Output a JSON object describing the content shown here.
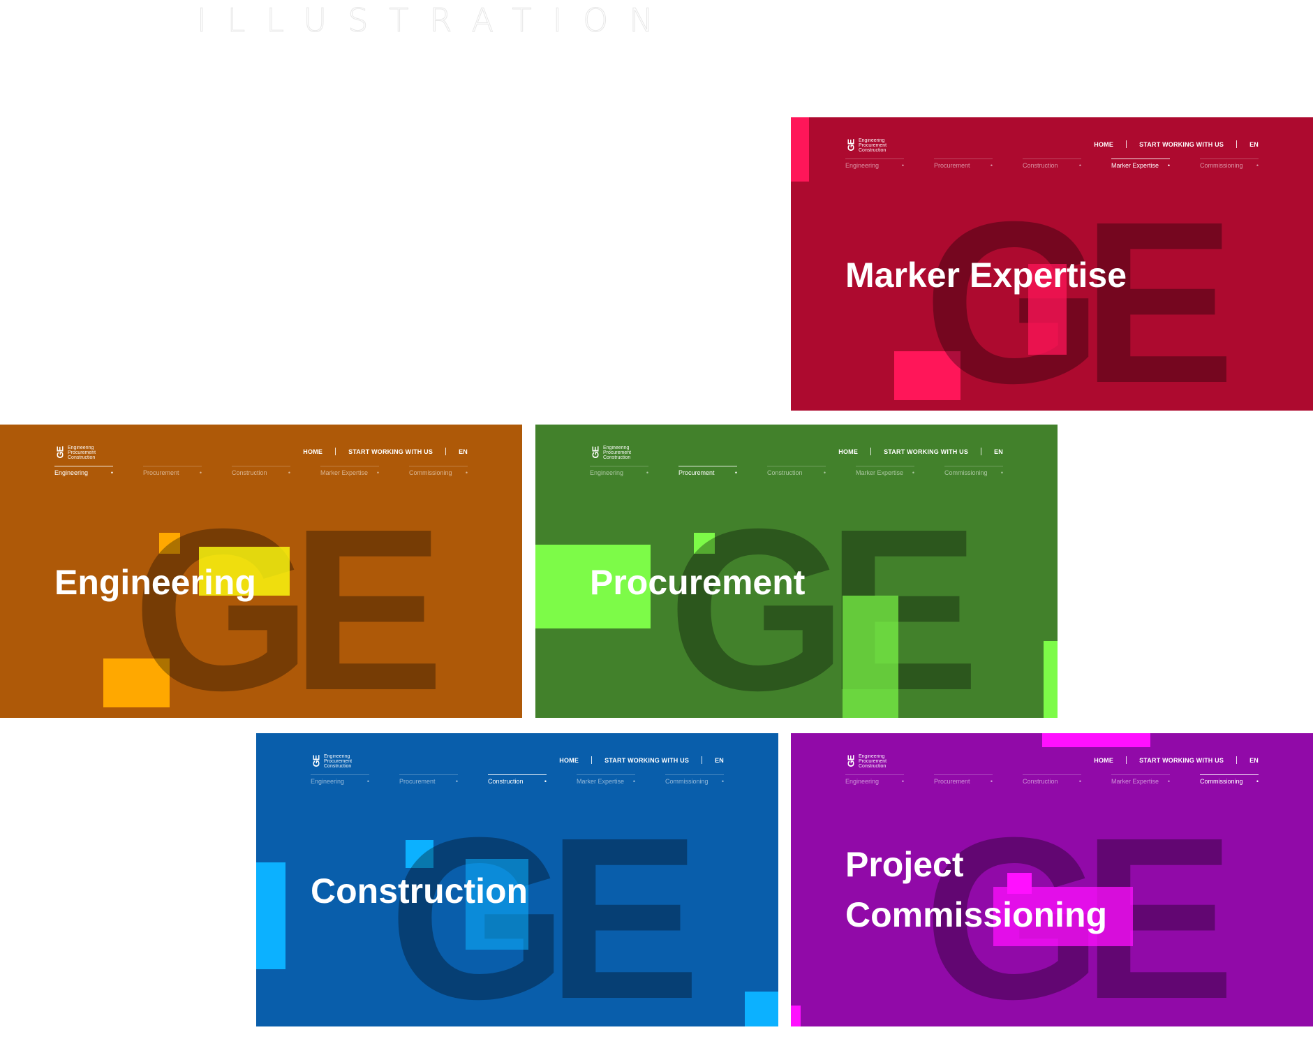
{
  "page": {
    "heading": "ILLUSTRATION"
  },
  "logo": {
    "mark": "GE",
    "line1": "Engineering",
    "line2": "Procurement",
    "line3": "Construction"
  },
  "topnav": {
    "home": "HOME",
    "start": "START WORKING WITH US",
    "lang": "EN"
  },
  "subnav_labels": [
    "Engineering",
    "Procurement",
    "Construction",
    "Marker Expertise",
    "Commissioning"
  ],
  "panels": {
    "marker": {
      "title": "Marker Expertise",
      "bg": "#ad0a2f",
      "accent": "#ff1659",
      "active": "Marker Expertise"
    },
    "engineering": {
      "title": "Engineering",
      "bg": "#ae5908",
      "accent": "#ffa800",
      "active": "Engineering"
    },
    "procurement": {
      "title": "Procurement",
      "bg": "#42812b",
      "accent": "#7dfb48",
      "active": "Procurement"
    },
    "construction": {
      "title": "Construction",
      "bg": "#095eab",
      "accent": "#0cb1ff",
      "active": "Construction"
    },
    "commissioning": {
      "title": "Project\nCommissioning",
      "bg": "#910aa8",
      "accent": "#ff10ff",
      "active": "Commissioning"
    }
  }
}
